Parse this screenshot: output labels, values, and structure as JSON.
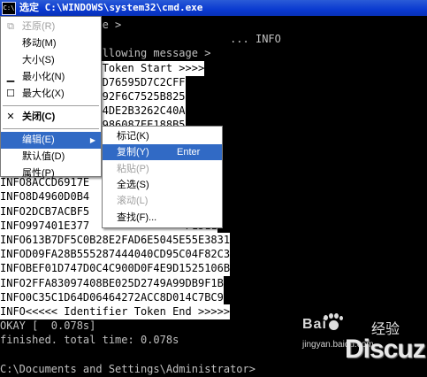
{
  "window": {
    "title": "选定 C:\\WINDOWS\\system32\\cmd.exe",
    "icon": "cmd-icon"
  },
  "console": {
    "lines": [
      "           device >",
      "                                    ... INFO",
      "           nt following message >",
      "        ntifier Token Start >>>>",
      "        950936FBD76595D7C2CFF",
      "        2D10E8AC92F6C7525B825",
      "        C9BBBA104DE2B3262C40A",
      "        5FF370CB986087EE188B5",
      "                             EB756",
      "                             99E0E",
      "                             D5E81",
      "INFO8ACCD6917E               87E5A",
      "INFO8D4960D0B4               82F0B",
      "INFO2DCB7ACBF5               0A71D",
      "INFO997401E377               F1511",
      "INFO613B7DF5C0B28E2FAD6E5045E55E3831",
      "INFOD09FA28B555287444040CD95C04F82C3",
      "INFOBEF01D747D0C4C900D0F4E9D1525106B",
      "INFO2FFA83097408BE025D2749A99DB9F1B",
      "INFO0C35C1D64D06464272ACC8D014C7BC9",
      "INFO<<<<< Identifier Token End >>>>>",
      "OKAY [  0.078s]",
      "finished. total time: 0.078s",
      "",
      "C:\\Documents and Settings\\Administrator>"
    ]
  },
  "system_menu": {
    "items": [
      {
        "label": "还原(R)",
        "icon": "restore-icon",
        "glyph": "⧉",
        "disabled": true
      },
      {
        "label": "移动(M)",
        "icon": "",
        "glyph": "",
        "disabled": false
      },
      {
        "label": "大小(S)",
        "icon": "",
        "glyph": "",
        "disabled": false
      },
      {
        "label": "最小化(N)",
        "icon": "minimize-icon",
        "glyph": "▁",
        "disabled": false
      },
      {
        "label": "最大化(X)",
        "icon": "maximize-icon",
        "glyph": "☐",
        "disabled": false
      },
      {
        "label": "关闭(C)",
        "icon": "close-icon",
        "glyph": "✕",
        "disabled": false,
        "bold": true
      },
      {
        "label": "编辑(E)",
        "icon": "",
        "glyph": "",
        "disabled": false,
        "highlighted": true,
        "submenu": true
      },
      {
        "label": "默认值(D)",
        "icon": "",
        "glyph": "",
        "disabled": false
      },
      {
        "label": "属性(P)",
        "icon": "",
        "glyph": "",
        "disabled": false
      }
    ],
    "submenu_arrow": "▶"
  },
  "edit_submenu": {
    "items": [
      {
        "label": "标记(K)",
        "shortcut": "",
        "disabled": false
      },
      {
        "label": "复制(Y)",
        "shortcut": "Enter",
        "disabled": false,
        "highlighted": true
      },
      {
        "label": "粘贴(P)",
        "shortcut": "",
        "disabled": true
      },
      {
        "label": "全选(S)",
        "shortcut": "",
        "disabled": false
      },
      {
        "label": "滚动(L)",
        "shortcut": "",
        "disabled": true
      },
      {
        "label": "查找(F)...",
        "shortcut": "",
        "disabled": false
      }
    ]
  },
  "watermark": {
    "brand": "Bai",
    "brand2": "经验",
    "site": "jingyan.baidu.com",
    "discuz": "Discuz!"
  },
  "colors": {
    "highlight": "#316ac5",
    "titlebar": "#0a3ad0",
    "console_bg": "#000000",
    "console_text": "#c0c0c0"
  }
}
